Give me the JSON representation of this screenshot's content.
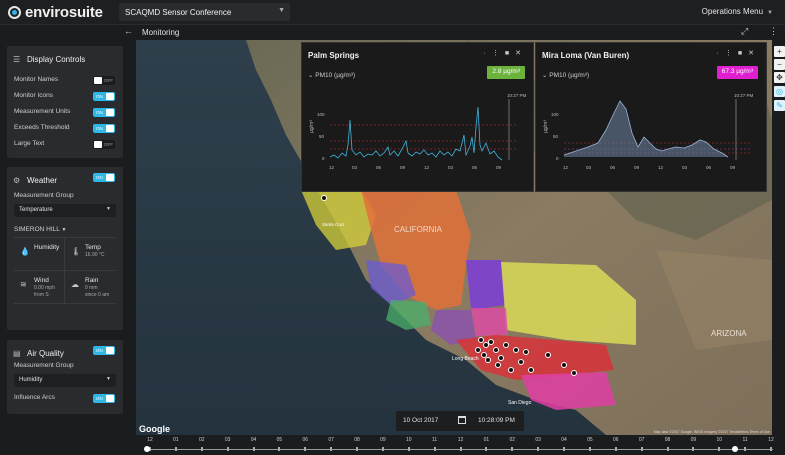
{
  "app": {
    "logo_text": "envirosuite",
    "project": "SCAQMD Sensor Conference",
    "menu_label": "Operations Menu",
    "page_title": "Monitoring"
  },
  "display_controls": {
    "title": "Display Controls",
    "rows": [
      {
        "label": "Monitor Names",
        "state": "OFF"
      },
      {
        "label": "Monitor Icons",
        "state": "ON"
      },
      {
        "label": "Measurement Units",
        "state": "ON"
      },
      {
        "label": "Exceeds Threshold",
        "state": "ON"
      },
      {
        "label": "Large Text",
        "state": "OFF"
      }
    ]
  },
  "weather": {
    "title": "Weather",
    "toggle": "ON",
    "group_label": "Measurement Group",
    "group_value": "Temperature",
    "station": "SIMERON HILL",
    "cells": [
      {
        "icon": "droplet-icon",
        "name": "Humidity",
        "value": ""
      },
      {
        "icon": "thermometer-icon",
        "name": "Temp",
        "value": "16.90 °C"
      },
      {
        "icon": "wind-icon",
        "name": "Wind",
        "value": "0.00 mph",
        "value2": "from S"
      },
      {
        "icon": "rain-cloud-icon",
        "name": "Rain",
        "value": "0 mm",
        "value2": "since 0 am"
      }
    ]
  },
  "air_quality": {
    "title": "Air Quality",
    "toggle": "ON",
    "group_label": "Measurement Group",
    "group_value": "Humidity",
    "influence_label": "Influence Arcs",
    "influence_state": "ON"
  },
  "map": {
    "google_label": "Google",
    "credit": "Map data ©2017 Google, INEGI Imagery ©2017 TerraMetrics   Terms of Use",
    "labels": [
      "CALIFORNIA",
      "ARIZONA",
      "Long Beach",
      "San Diego",
      "Santa Cruz"
    ]
  },
  "panels": [
    {
      "title": "Palm Springs",
      "metric": "PM10 (µg/m³)",
      "badge": "2.8 µg/m³",
      "badge_color": "#6cb33e",
      "time_label": "10:27 PM",
      "y_ticks": [
        "100",
        "50",
        "0"
      ],
      "x_ticks": [
        "12",
        "03",
        "06",
        "09",
        "12",
        "03",
        "06",
        "09"
      ]
    },
    {
      "title": "Mira Loma (Van Buren)",
      "metric": "PM10 (µg/m³)",
      "badge": "67.3 µg/m³",
      "badge_color": "#e020d0",
      "time_label": "10:27 PM",
      "y_ticks": [
        "100",
        "50",
        "0"
      ],
      "x_ticks": [
        "12",
        "03",
        "06",
        "09",
        "12",
        "03",
        "06",
        "09"
      ]
    }
  ],
  "datetime": {
    "date": "10 Oct 2017",
    "time": "10:28:09 PM"
  },
  "timeline": {
    "hours": [
      "12",
      "01",
      "02",
      "03",
      "04",
      "05",
      "06",
      "07",
      "08",
      "09",
      "10",
      "11",
      "12",
      "01",
      "02",
      "03",
      "04",
      "05",
      "06",
      "07",
      "08",
      "09",
      "10",
      "11",
      "12"
    ]
  }
}
